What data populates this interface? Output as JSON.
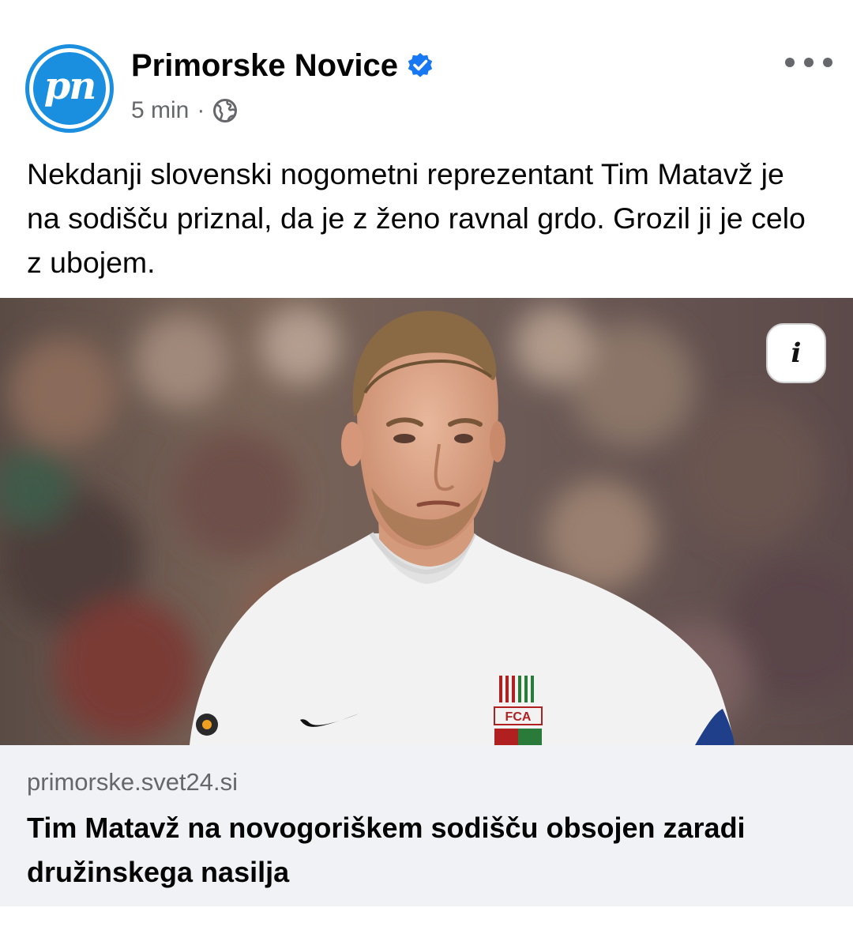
{
  "post": {
    "page_name": "Primorske Novice",
    "avatar_text": "pn",
    "time": "5 min",
    "separator": "·",
    "audience_icon": "globe-icon",
    "verified_icon": "verified-badge-icon",
    "more_icon": "more-options-icon",
    "text": "Nekdanji slovenski nogometni reprezentant Tim Matavž je na sodišču priznal, da je z ženo ravnal grdo. Grozil ji je celo z ubojem."
  },
  "photo": {
    "subject": "football player in white kit",
    "info_icon": "info-icon",
    "info_glyph": "i",
    "crest_text": "FCA"
  },
  "link_preview": {
    "domain": "primorske.svet24.si",
    "title": "Tim Matavž na novogoriškem sodišču obsojen zaradi družinskega nasilja"
  },
  "colors": {
    "brand_blue": "#1a8fe0",
    "verified_blue": "#1877f2",
    "secondary_text": "#65676b",
    "preview_bg": "#f0f2f5"
  }
}
